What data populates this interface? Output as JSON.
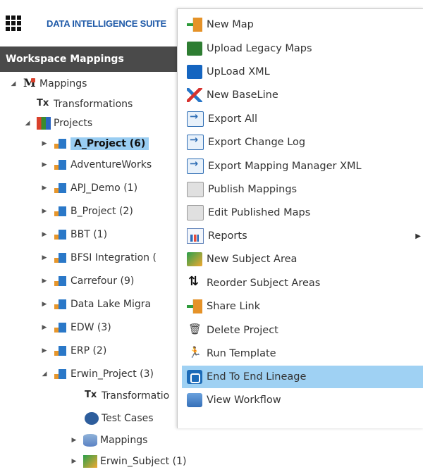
{
  "app": {
    "title": "DATA INTELLIGENCE SUITE"
  },
  "workspace": {
    "title": "Workspace Mappings"
  },
  "tree": {
    "root": "Mappings",
    "transformations": "Transformations",
    "projects": "Projects",
    "items": [
      "A_Project (6)",
      "AdventureWorks",
      "APJ_Demo (1)",
      "B_Project (2)",
      "BBT (1)",
      "BFSI Integration (",
      "Carrefour (9)",
      "Data Lake Migra",
      "EDW (3)",
      "ERP (2)",
      "Erwin_Project (3)"
    ],
    "erwin_children": [
      "Transformatio",
      "Test Cases",
      "Mappings",
      "Erwin_Subject (1)"
    ]
  },
  "menu": {
    "items": [
      {
        "label": "New Map",
        "icon": "new-map-icon"
      },
      {
        "label": "Upload Legacy Maps",
        "icon": "excel-upload-icon"
      },
      {
        "label": "UpLoad XML",
        "icon": "xml-upload-icon"
      },
      {
        "label": "New BaseLine",
        "icon": "baseline-icon"
      },
      {
        "label": "Export All",
        "icon": "export-icon"
      },
      {
        "label": "Export Change Log",
        "icon": "export-icon"
      },
      {
        "label": "Export Mapping Manager XML",
        "icon": "export-icon"
      },
      {
        "label": "Publish Mappings",
        "icon": "publish-icon"
      },
      {
        "label": "Edit Published Maps",
        "icon": "publish-icon"
      },
      {
        "label": "Reports",
        "icon": "reports-icon"
      },
      {
        "label": "New Subject Area",
        "icon": "subject-area-icon"
      },
      {
        "label": "Reorder Subject Areas",
        "icon": "reorder-icon"
      },
      {
        "label": "Share Link",
        "icon": "share-link-icon"
      },
      {
        "label": "Delete Project",
        "icon": "trash-icon"
      },
      {
        "label": "Run Template",
        "icon": "run-icon"
      },
      {
        "label": "End To End Lineage",
        "icon": "lineage-icon"
      },
      {
        "label": "View Workflow",
        "icon": "workflow-icon"
      }
    ],
    "highlighted": "End To End Lineage"
  }
}
